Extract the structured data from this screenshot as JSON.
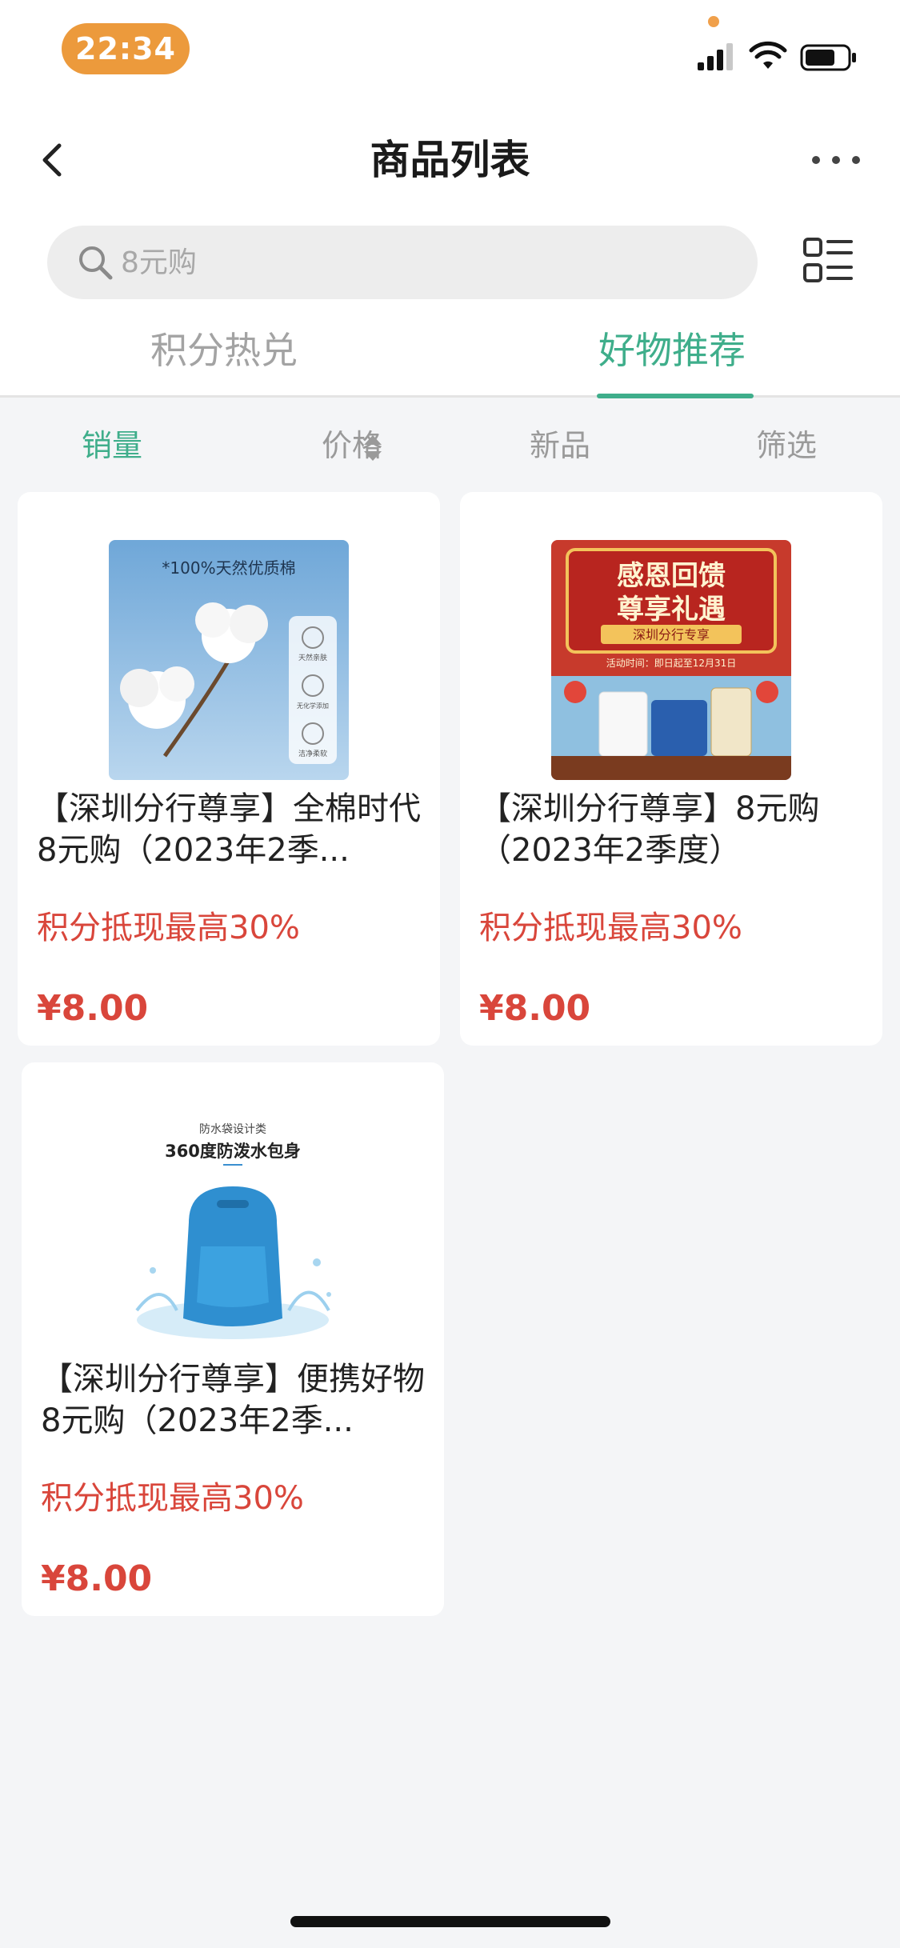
{
  "status_bar": {
    "time": "22:34",
    "icons": [
      "signal-icon",
      "wifi-icon",
      "battery-icon"
    ],
    "battery_level": 0.7
  },
  "nav": {
    "title": "商品列表",
    "back_icon": "chevron-left-icon",
    "more_icon": "more-horizontal-icon"
  },
  "search": {
    "placeholder": "8元购",
    "value": ""
  },
  "tabs": [
    {
      "label": "积分热兑",
      "active": false
    },
    {
      "label": "好物推荐",
      "active": true
    }
  ],
  "sort": {
    "sales": "销量",
    "price": "价格",
    "new": "新品",
    "filter": "筛选",
    "active": "sales"
  },
  "products": [
    {
      "title": "【深圳分行尊享】全棉时代8元购（2023年2季...",
      "promo": "积分抵现最高30%",
      "price": "¥8.00",
      "image_text": "*100%天然优质棉",
      "image_badges": [
        "天然亲肤",
        "无化学添加",
        "洁净柔软"
      ]
    },
    {
      "title": "【深圳分行尊享】8元购（2023年2季度）",
      "promo": "积分抵现最高30%",
      "price": "¥8.00",
      "image_text": [
        "感恩回馈",
        "尊享礼遇",
        "深圳分行专享",
        "活动时间：即日起至12月31日"
      ]
    },
    {
      "title": "【深圳分行尊享】便携好物8元购（2023年2季...",
      "promo": "积分抵现最高30%",
      "price": "¥8.00",
      "image_text": [
        "防水袋设计类",
        "360度防泼水包身"
      ]
    }
  ],
  "colors": {
    "accent": "#3fae8b",
    "price": "#d9463b",
    "time_pill": "#ec9a3c",
    "background": "#f4f5f7"
  }
}
